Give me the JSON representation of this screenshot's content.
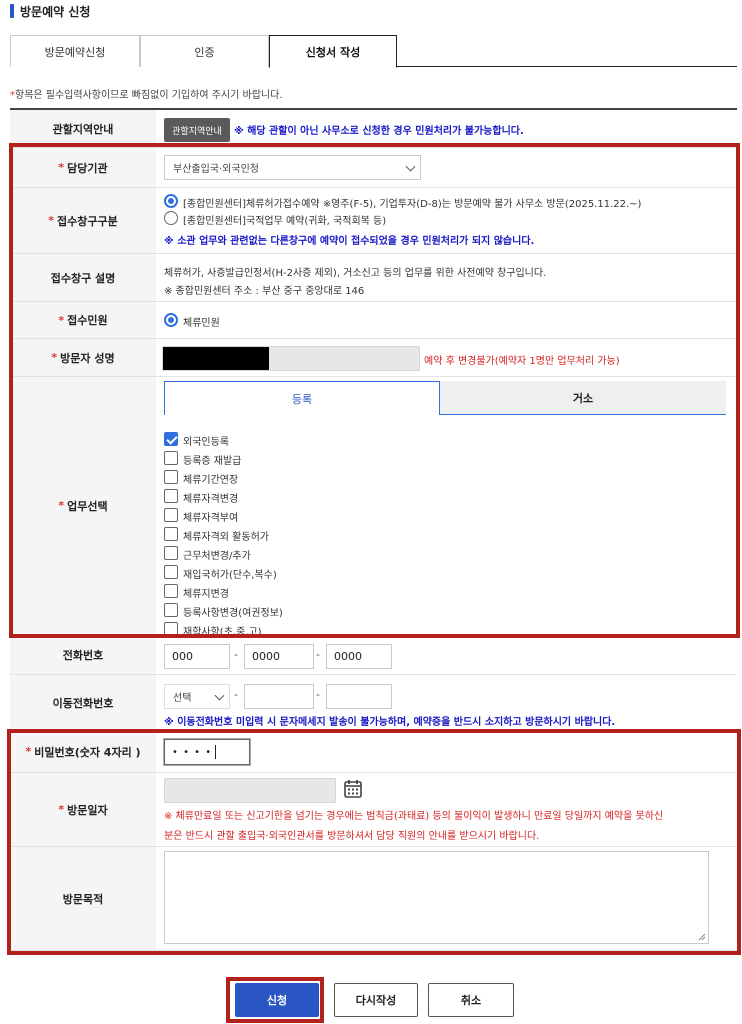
{
  "page": {
    "title": "방문예약 신청"
  },
  "tabs": [
    {
      "label": "방문예약신청"
    },
    {
      "label": "인증"
    },
    {
      "label": "신청서 작성"
    }
  ],
  "notice": {
    "star": "*",
    "text": "항목은 필수입력사항이므로 빠짐없이 기입하여 주시기 바랍니다."
  },
  "form": {
    "jurisdiction": {
      "label": "관할지역안내",
      "button": "관할지역안내",
      "warning": "※ 해당 관할이 아닌 사무소로 신청한 경우 민원처리가 불가능합니다."
    },
    "agency": {
      "label": "담당기관",
      "selected": "부산출입국·외국인청"
    },
    "window_type": {
      "label": "접수창구구분",
      "options": [
        "[종합민원센터]체류허가접수예약 ※영주(F-5), 기업투자(D-8)는 방문예약 불가 사무소 방문(2025.11.22.~)",
        "[종합민원센터]국적업무 예약(귀화, 국적회복 등)"
      ],
      "note": "※ 소관 업무와 관련없는 다른창구에 예약이 접수되었을 경우 민원처리가 되지 않습니다."
    },
    "window_desc": {
      "label": "접수창구 설명",
      "line1": "체류허가, 사증발급인정서(H-2사증 제외), 거소신고 등의 업무를 위한 사전예약 창구입니다.",
      "line2": "※ 종합민원센터 주소 : 부산 중구 중앙대로 146"
    },
    "civil": {
      "label": "접수민원",
      "option": "체류민원"
    },
    "visitor": {
      "label": "방문자 성명",
      "note": "예약 후 변경불가(예약자 1명만 업무처리 가능)"
    },
    "work": {
      "label": "업무선택",
      "tabs": [
        "등록",
        "거소"
      ],
      "items": [
        {
          "label": "외국인등록",
          "checked": true
        },
        {
          "label": "등록증 재발급",
          "checked": false
        },
        {
          "label": "체류기간연장",
          "checked": false
        },
        {
          "label": "체류자격변경",
          "checked": false
        },
        {
          "label": "체류자격부여",
          "checked": false
        },
        {
          "label": "체류자격외 활동허가",
          "checked": false
        },
        {
          "label": "근무처변경/추가",
          "checked": false
        },
        {
          "label": "재입국허가(단수,복수)",
          "checked": false
        },
        {
          "label": "체류지변경",
          "checked": false
        },
        {
          "label": "등록사항변경(여권정보)",
          "checked": false
        },
        {
          "label": "재학사항(초,중,고)",
          "checked": false
        }
      ]
    },
    "phone": {
      "label": "전화번호",
      "p1": "000",
      "p2": "0000",
      "p3": "0000",
      "sep": "-"
    },
    "mobile": {
      "label": "이동전화번호",
      "select": "선택",
      "sep": "-",
      "note": "※ 이동전화번호 미입력 시 문자메세지 발송이 불가능하며, 예약증을 반드시 소지하고 방문하시기 바랍니다."
    },
    "password": {
      "label": "비밀번호(숫자 4자리 )",
      "value": "• • • •"
    },
    "visit_date": {
      "label": "방문일자",
      "warning1": "※ 체류만료일 또는 신고기한을 넘기는 경우에는 범칙금(과태료) 등의 불이익이 발생하니 만료일 당일까지 예약을 못하신",
      "warning2": "분은 반드시 관할 출입국·외국인관서를 방문하셔서 담당 직원의 안내를 받으시기 바랍니다."
    },
    "purpose": {
      "label": "방문목적"
    },
    "required_mark": "*"
  },
  "buttons": {
    "submit": "신청",
    "rewrite": "다시작성",
    "cancel": "취소"
  },
  "colors": {
    "accent": "#2a55c5",
    "highlight": "#b3211d",
    "warning_blue": "#1818c8",
    "warning_red": "#d42222"
  }
}
